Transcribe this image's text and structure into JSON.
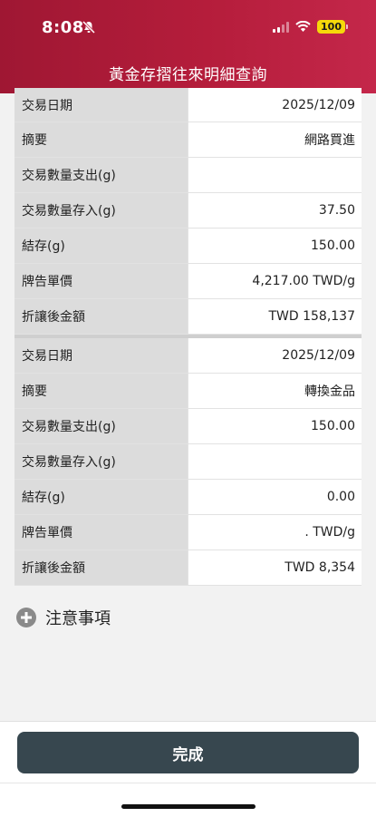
{
  "status_bar": {
    "time": "8:08",
    "battery": "100"
  },
  "header": {
    "title": "黃金存摺往來明細查詢"
  },
  "records": [
    {
      "rows": [
        {
          "label": "交易日期",
          "value": "2025/12/09"
        },
        {
          "label": "摘要",
          "value": "網路買進"
        },
        {
          "label": "交易數量支出(g)",
          "value": ""
        },
        {
          "label": "交易數量存入(g)",
          "value": "37.50"
        },
        {
          "label": "結存(g)",
          "value": "150.00"
        },
        {
          "label": "牌告單價",
          "value": "4,217.00 TWD/g"
        },
        {
          "label": "折讓後金額",
          "value": "TWD 158,137"
        }
      ]
    },
    {
      "rows": [
        {
          "label": "交易日期",
          "value": "2025/12/09"
        },
        {
          "label": "摘要",
          "value": "轉換金品"
        },
        {
          "label": "交易數量支出(g)",
          "value": "150.00"
        },
        {
          "label": "交易數量存入(g)",
          "value": ""
        },
        {
          "label": "結存(g)",
          "value": "0.00"
        },
        {
          "label": "牌告單價",
          "value": ". TWD/g"
        },
        {
          "label": "折讓後金額",
          "value": "TWD 8,354"
        }
      ]
    }
  ],
  "notice": {
    "label": "注意事項"
  },
  "footer": {
    "done_label": "完成"
  },
  "icons": {
    "status": [
      "bell-slash-icon",
      "signal-icon",
      "wifi-icon",
      "battery-icon"
    ],
    "notice": "plus-circle-icon"
  }
}
